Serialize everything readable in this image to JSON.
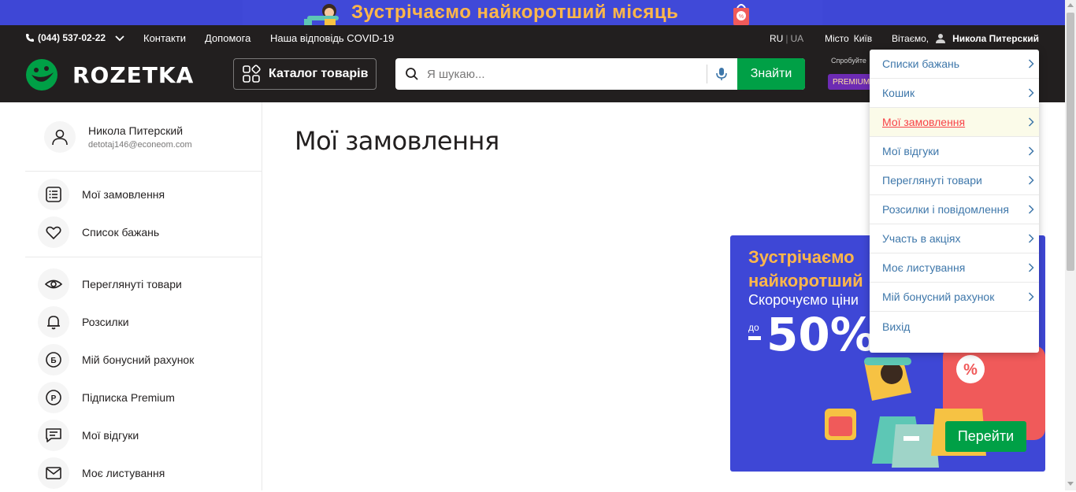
{
  "promo_banner": {
    "title": "Зустрічаємо найкоротший місяць"
  },
  "topbar": {
    "phone": "(044) 537-02-22",
    "links": [
      "Контакти",
      "Допомога",
      "Наша відповідь COVID-19"
    ],
    "lang_active": "RU",
    "lang_inactive": "UA",
    "lang_sep": "|",
    "city_label": "Місто",
    "city_value": "Київ",
    "greeting": "Вітаємо,",
    "user_name": "Никола Питерский"
  },
  "mainbar": {
    "logo_text": "ROZETKA",
    "catalog_label": "Каталог товарів",
    "search_placeholder": "Я шукаю...",
    "search_button": "Знайти",
    "premium_try": "Спробуйте",
    "premium_badge": "PREMIUM"
  },
  "profile": {
    "name": "Никола Питерский",
    "email": "detotaj146@econeom.com"
  },
  "sidebar": {
    "group1": [
      {
        "label": "Мої замовлення",
        "icon": "orders-list-icon"
      },
      {
        "label": "Список бажань",
        "icon": "heart-icon"
      }
    ],
    "group2": [
      {
        "label": "Переглянуті товари",
        "icon": "eye-icon"
      },
      {
        "label": "Розсилки",
        "icon": "bell-icon"
      },
      {
        "label": "Мій бонусний рахунок",
        "icon": "bonus-icon"
      },
      {
        "label": "Підписка Premium",
        "icon": "premium-icon"
      },
      {
        "label": "Мої відгуки",
        "icon": "reviews-icon"
      },
      {
        "label": "Моє листування",
        "icon": "mail-icon"
      }
    ]
  },
  "main": {
    "title": "Мої замовлення"
  },
  "promo_card": {
    "line1": "Зустрічаємо",
    "line2": "найкоротший",
    "subtitle": "Скорочуємо ціни",
    "prefix": "до",
    "percent": "50%",
    "button": "Перейти"
  },
  "user_menu": {
    "active_index": 2,
    "items": [
      "Списки бажань",
      "Кошик",
      "Мої замовлення",
      "Мої відгуки",
      "Переглянуті товари",
      "Розсилки і повідомлення",
      "Участь в акціях",
      "Моє листування",
      "Мій бонусний рахунок",
      "Вихід"
    ]
  },
  "colors": {
    "header_bg": "#221f1f",
    "accent_green": "#00a046",
    "promo_blue": "#3e47d6",
    "promo_orange": "#ffb74a",
    "link_blue": "#3e77aa",
    "active_red": "#f84147"
  }
}
